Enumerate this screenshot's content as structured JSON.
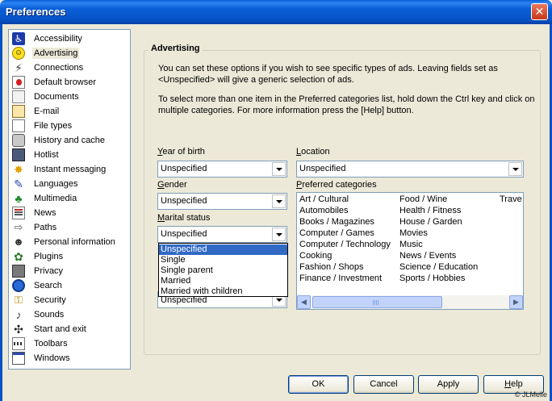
{
  "window": {
    "title": "Preferences",
    "close_label": "✕"
  },
  "sidebar": {
    "items": [
      {
        "label": "Accessibility",
        "icon": "accessibility-icon",
        "glyph": "♿"
      },
      {
        "label": "Advertising",
        "icon": "smiley-icon",
        "glyph": "☺"
      },
      {
        "label": "Connections",
        "icon": "plug-icon",
        "glyph": "⚡"
      },
      {
        "label": "Default browser",
        "icon": "browser-icon",
        "glyph": ""
      },
      {
        "label": "Documents",
        "icon": "documents-icon",
        "glyph": ""
      },
      {
        "label": "E-mail",
        "icon": "envelope-icon",
        "glyph": ""
      },
      {
        "label": "File types",
        "icon": "file-types-icon",
        "glyph": ""
      },
      {
        "label": "History and cache",
        "icon": "history-icon",
        "glyph": ""
      },
      {
        "label": "Hotlist",
        "icon": "hotlist-icon",
        "glyph": ""
      },
      {
        "label": "Instant messaging",
        "icon": "instant-messaging-icon",
        "glyph": "✸"
      },
      {
        "label": "Languages",
        "icon": "languages-icon",
        "glyph": "✎"
      },
      {
        "label": "Multimedia",
        "icon": "multimedia-icon",
        "glyph": "♣"
      },
      {
        "label": "News",
        "icon": "news-icon",
        "glyph": ""
      },
      {
        "label": "Paths",
        "icon": "paths-icon",
        "glyph": "⇨"
      },
      {
        "label": "Personal information",
        "icon": "person-icon",
        "glyph": "☻"
      },
      {
        "label": "Plugins",
        "icon": "plugins-icon",
        "glyph": "✿"
      },
      {
        "label": "Privacy",
        "icon": "privacy-icon",
        "glyph": ""
      },
      {
        "label": "Search",
        "icon": "search-icon",
        "glyph": ""
      },
      {
        "label": "Security",
        "icon": "key-icon",
        "glyph": "⚿"
      },
      {
        "label": "Sounds",
        "icon": "sounds-icon",
        "glyph": "♪"
      },
      {
        "label": "Start and exit",
        "icon": "start-exit-icon",
        "glyph": "✣"
      },
      {
        "label": "Toolbars",
        "icon": "toolbars-icon",
        "glyph": ""
      },
      {
        "label": "Windows",
        "icon": "windows-icon",
        "glyph": ""
      }
    ],
    "selected_index": 1
  },
  "panel": {
    "title": "Advertising",
    "intro": "You can set these options if you wish to see specific types of ads. Leaving fields set as <Unspecified> will give a generic selection of ads.",
    "hint": "To select more than one item in the Preferred categories list, hold down the Ctrl key and click on multiple categories. For more information press the [Help] button."
  },
  "form": {
    "year_of_birth": {
      "label_u": "Y",
      "label_rest": "ear of birth",
      "value": "Unspecified"
    },
    "gender": {
      "label_u": "G",
      "label_rest": "ender",
      "value": "Unspecified"
    },
    "marital_status": {
      "label_u": "M",
      "label_rest": "arital status",
      "value": "Unspecified",
      "options": [
        "Unspecified",
        "Single",
        "Single parent",
        "Married",
        "Married with children"
      ],
      "highlighted_index": 0
    },
    "hidden_combo_value": "Unspecified",
    "location": {
      "label_u": "L",
      "label_rest": "ocation",
      "value": "Unspecified"
    },
    "preferred_categories": {
      "label_u": "P",
      "label_rest": "referred categories",
      "columns": [
        [
          "Art / Cultural",
          "Automobiles",
          "Books / Magazines",
          "Computer / Games",
          "Computer / Technology",
          "Cooking",
          "Fashion / Shops",
          "Finance / Investment"
        ],
        [
          "Food / Wine",
          "Health / Fitness",
          "House / Garden",
          "Movies",
          "Music",
          "News / Events",
          "Science / Education",
          "Sports / Hobbies"
        ],
        [
          "Trave"
        ]
      ]
    }
  },
  "buttons": {
    "ok": "OK",
    "cancel": "Cancel",
    "apply": "Apply",
    "help_u": "H",
    "help_rest": "elp"
  },
  "footer": {
    "copyright": "© JLMelle"
  }
}
